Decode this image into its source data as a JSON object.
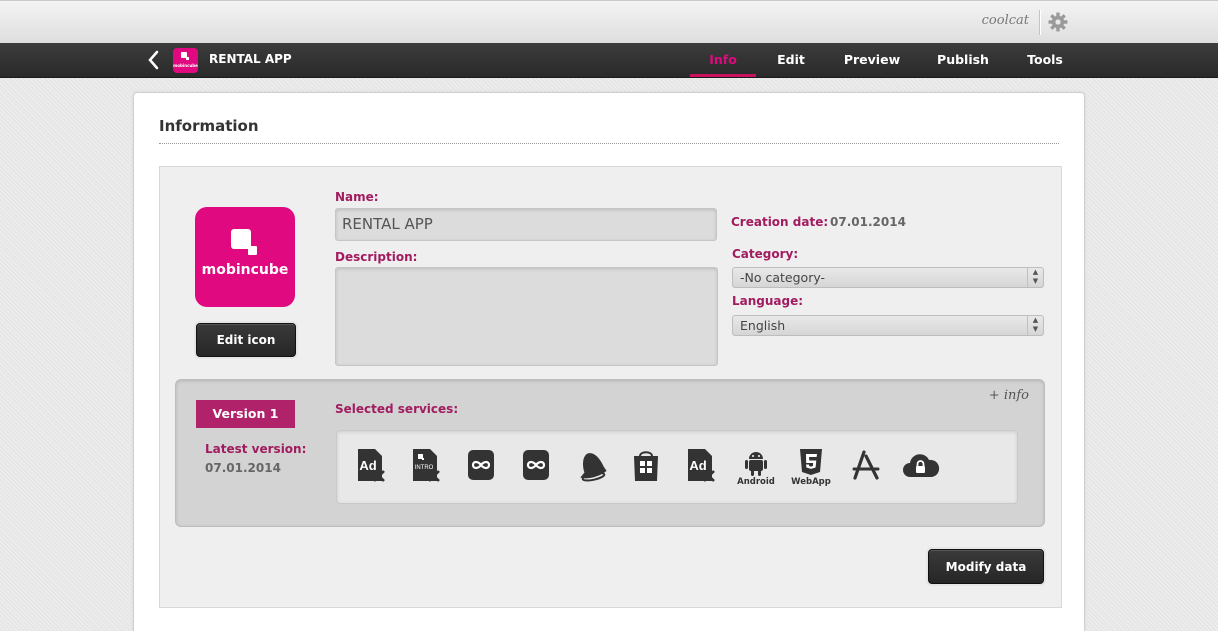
{
  "user": {
    "name": "coolcat",
    "settings_icon": "gear-icon"
  },
  "nav": {
    "app_name": "RENTAL APP",
    "logo_text": "mobincube",
    "tabs": [
      {
        "label": "Info",
        "active": true
      },
      {
        "label": "Edit",
        "active": false
      },
      {
        "label": "Preview",
        "active": false
      },
      {
        "label": "Publish",
        "active": false
      },
      {
        "label": "Tools",
        "active": false
      }
    ]
  },
  "page": {
    "title": "Information"
  },
  "info": {
    "logo_text": "mobincube",
    "edit_icon_label": "Edit icon",
    "name_label": "Name:",
    "name_value": "RENTAL APP",
    "description_label": "Description:",
    "description_value": "",
    "creation_date_label": "Creation date:",
    "creation_date_value": "07.01.2014",
    "category_label": "Category:",
    "category_value": "-No category-",
    "language_label": "Language:",
    "language_value": "English"
  },
  "version": {
    "badge": "Version 1",
    "latest_label": "Latest version:",
    "latest_value": "07.01.2014",
    "services_label": "Selected services:",
    "more_info": "+ info",
    "services": [
      {
        "icon": "ad-disabled-icon",
        "label": ""
      },
      {
        "icon": "intro-disabled-icon",
        "label": ""
      },
      {
        "icon": "infinity-icon",
        "label": ""
      },
      {
        "icon": "infinity-icon",
        "label": ""
      },
      {
        "icon": "bell-icon",
        "label": ""
      },
      {
        "icon": "windows-store-icon",
        "label": ""
      },
      {
        "icon": "ad-disabled-icon",
        "label": ""
      },
      {
        "icon": "android-icon",
        "label": "Android"
      },
      {
        "icon": "html5-icon",
        "label": "WebApp"
      },
      {
        "icon": "app-store-icon",
        "label": ""
      },
      {
        "icon": "cloud-lock-icon",
        "label": ""
      }
    ]
  },
  "actions": {
    "modify_label": "Modify data"
  },
  "colors": {
    "accent": "#e0097f",
    "label": "#a11c5f",
    "badge": "#b02269",
    "nav_bg": "#333333"
  }
}
